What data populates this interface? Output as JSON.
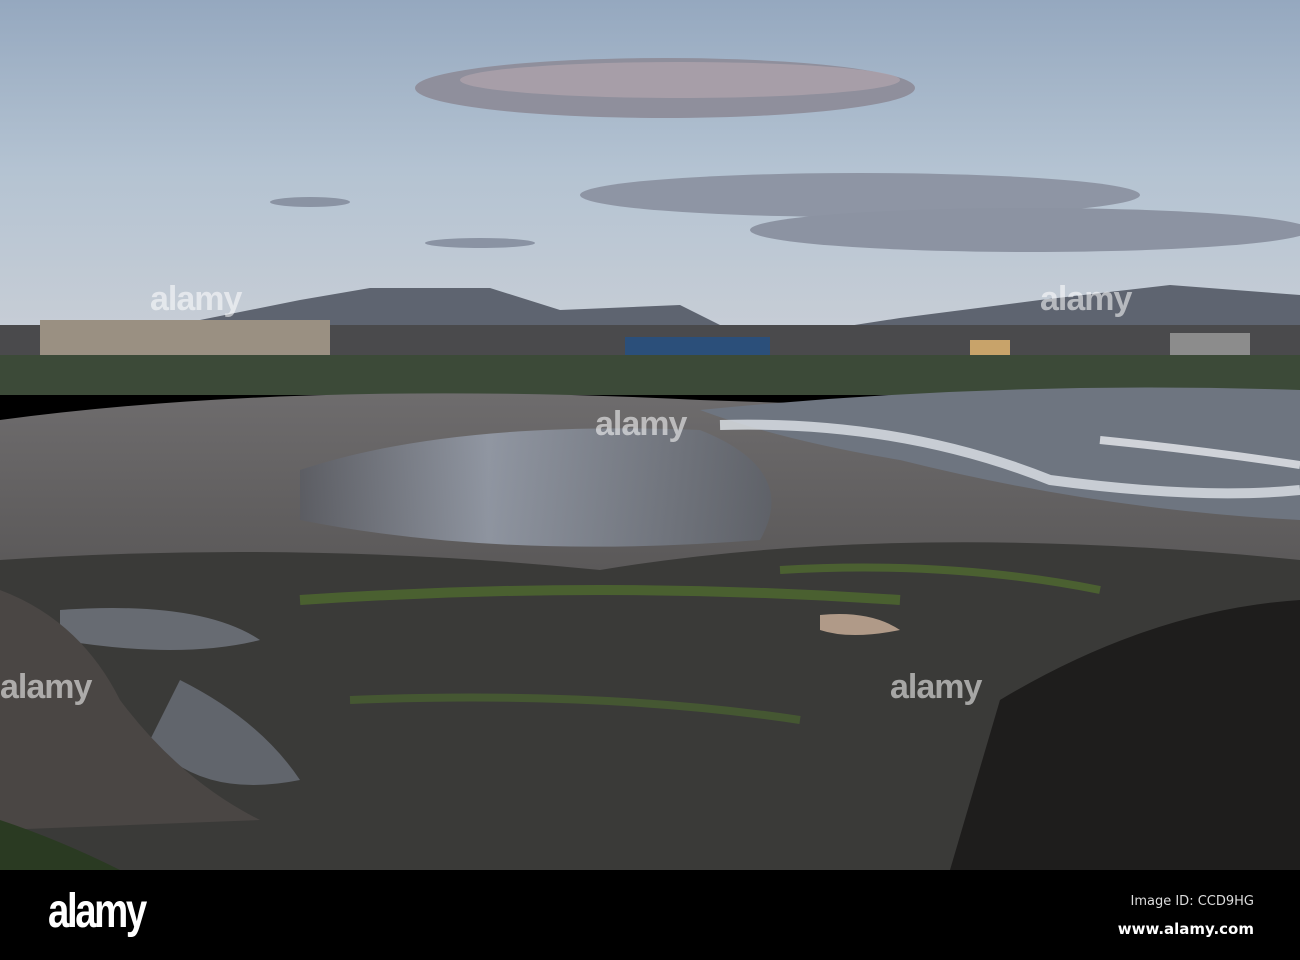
{
  "watermark": "alamy",
  "footer": {
    "logo": "alamy",
    "image_id": "Image ID: CCD9HG",
    "website": "www.alamy.com"
  }
}
